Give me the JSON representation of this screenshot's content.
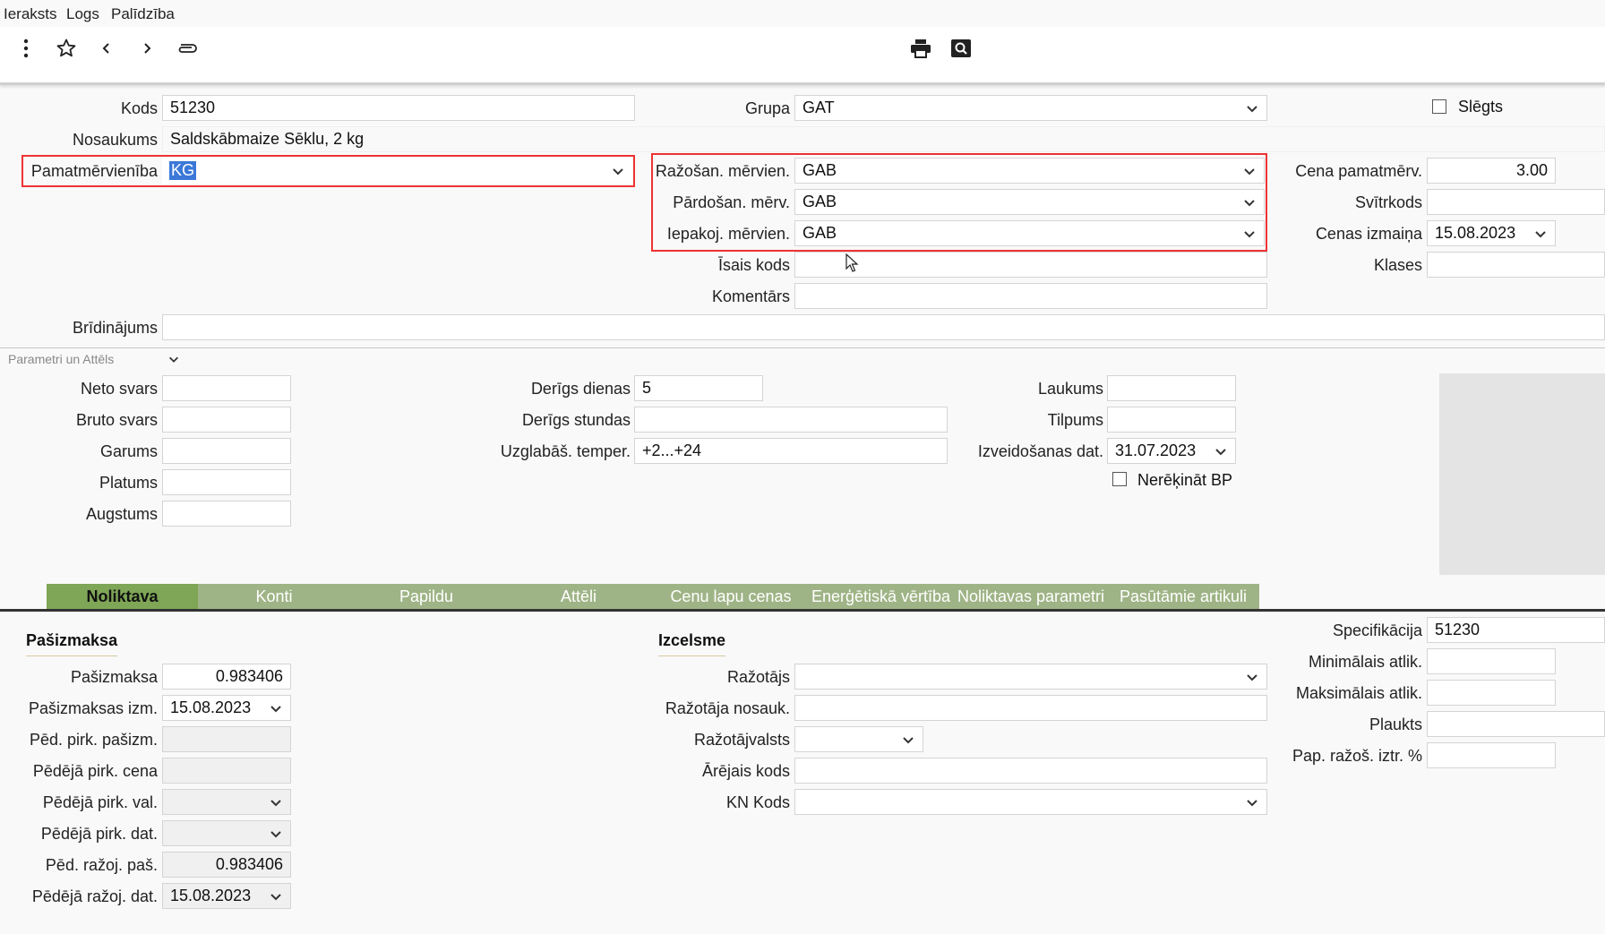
{
  "menu": {
    "items": [
      "Ieraksts",
      "Logs",
      "Palīdzība"
    ]
  },
  "toolbar": {
    "icons": [
      "more-vertical-icon",
      "star-icon",
      "chevron-left-icon",
      "chevron-right-icon",
      "paperclip-icon",
      "printer-icon",
      "search-preview-icon"
    ]
  },
  "top": {
    "kods_label": "Kods",
    "kods_value": "51230",
    "nosaukums_label": "Nosaukums",
    "nosaukums_value": "Saldskābmaize Sēklu, 2 kg",
    "pamat_label": "Pamatmērvienība",
    "pamat_value": "KG",
    "grupa_label": "Grupa",
    "grupa_value": "GAT",
    "slegts_label": "Slēgts",
    "razosan_label": "Ražošan. mērvien.",
    "razosan_value": "GAB",
    "pardosan_label": "Pārdošan. mērv.",
    "pardosan_value": "GAB",
    "iepakoj_label": "Iepakoj. mērvien.",
    "iepakoj_value": "GAB",
    "isais_label": "Īsais kods",
    "isais_value": "",
    "komentars_label": "Komentārs",
    "komentars_value": "",
    "cena_label": "Cena pamatmērv.",
    "cena_value": "3.00",
    "svitr_label": "Svītrkods",
    "svitr_value": "",
    "cenas_izm_label": "Cenas izmaiņa",
    "cenas_izm_value": "15.08.2023",
    "klases_label": "Klases",
    "klases_value": "",
    "bridinajums_label": "Brīdinājums",
    "bridinajums_value": ""
  },
  "params": {
    "section_label": "Parametri un Attēls",
    "neto_label": "Neto svars",
    "bruto_label": "Bruto svars",
    "garums_label": "Garums",
    "platums_label": "Platums",
    "augstums_label": "Augstums",
    "derigs_dienas_label": "Derīgs dienas",
    "derigs_dienas_value": "5",
    "derigs_stundas_label": "Derīgs stundas",
    "derigs_stundas_value": "",
    "uzglabas_label": "Uzglabāš. temper.",
    "uzglabas_value": "+2...+24",
    "laukums_label": "Laukums",
    "tilpums_label": "Tilpums",
    "izveid_label": "Izveidošanas dat.",
    "izveid_value": "31.07.2023",
    "nerekinat_label": "Nerēķināt BP"
  },
  "tabs": [
    "Noliktava",
    "Konti",
    "Papildu",
    "Attēli",
    "Cenu lapu cenas",
    "Enerģētiskā vērtība",
    "Noliktavas parametri",
    "Pasūtāmie artikuli"
  ],
  "pasizmaksa": {
    "title": "Pašizmaksa",
    "pasizmaksa_label": "Pašizmaksa",
    "pasizmaksa_value": "0.983406",
    "pas_izm_label": "Pašizmaksas izm.",
    "pas_izm_value": "15.08.2023",
    "ped_pirk_pas_label": "Pēd. pirk. pašizm.",
    "ped_pirk_cena_label": "Pēdējā pirk. cena",
    "ped_pirk_val_label": "Pēdējā pirk. val.",
    "ped_pirk_dat_label": "Pēdējā pirk. dat.",
    "ped_razoj_pas_label": "Pēd. ražoj. paš.",
    "ped_razoj_pas_value": "0.983406",
    "ped_razoj_dat_label": "Pēdējā ražoj. dat.",
    "ped_razoj_dat_value": "15.08.2023"
  },
  "izcelsme": {
    "title": "Izcelsme",
    "razotajs_label": "Ražotājs",
    "razotaja_nos_label": "Ražotāja nosauk.",
    "razotajvalsts_label": "Ražotājvalsts",
    "arejais_label": "Ārējais kods",
    "kn_label": "KN Kods"
  },
  "right": {
    "spec_label": "Specifikācija",
    "spec_value": "51230",
    "min_label": "Minimālais atlik.",
    "max_label": "Maksimālais atlik.",
    "plaukts_label": "Plaukts",
    "pap_label": "Pap. ražoš. iztr. %"
  }
}
